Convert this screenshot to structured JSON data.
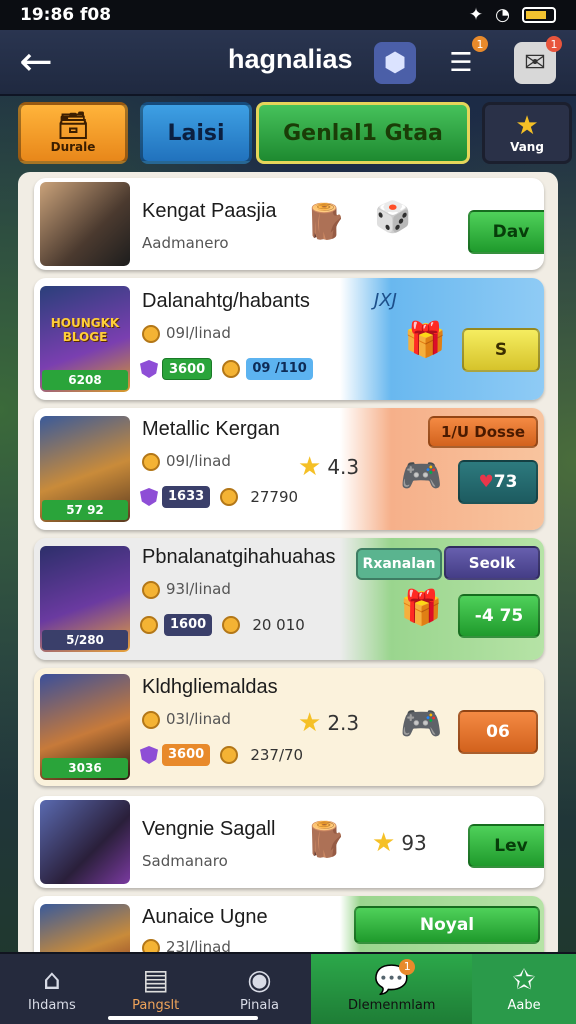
{
  "status_bar": {
    "time": "19:86 f08",
    "icons": [
      "gamepad-icon",
      "wifi-icon",
      "battery-icon"
    ]
  },
  "header": {
    "title": "hagnalias",
    "back_icon": "arrow-left-icon",
    "icons": [
      {
        "name": "cube-icon",
        "badge": ""
      },
      {
        "name": "list-icon",
        "badge": "1"
      },
      {
        "name": "chat-icon",
        "badge": "1"
      }
    ]
  },
  "tabs": [
    {
      "label": "Durale",
      "icon": "chest-icon"
    },
    {
      "label": "Laisi"
    },
    {
      "label": "Genlal1 Gtaa"
    },
    {
      "label": "Vang",
      "icon": "star-icon"
    }
  ],
  "rows": [
    {
      "title": "Kengat Paasjia",
      "subtitle": "Aadmanero",
      "button": "Dav",
      "theme": "plain"
    },
    {
      "title": "Dalanahtg/habants",
      "sub": "09l/linad",
      "thumb_tag": "6208",
      "thumb_banner": "HOUNGKK BLOGE",
      "stat_a": "3600",
      "stat_b": "09 /110",
      "right_label": "JXJ",
      "button": "S",
      "theme": "blue"
    },
    {
      "title": "Metallic Kergan",
      "sub": "09l/linad",
      "thumb_tag": "57 92",
      "stat_a": "1633",
      "stat_b": "27790",
      "rating": "4.3",
      "right_label": "1/U Dosse",
      "button": "73",
      "theme": "orange"
    },
    {
      "title": "Pbnalanatgihahuahas",
      "sub": "93l/linad",
      "thumb_tag": "5/280",
      "stat_a": "1600",
      "stat_b": "20 010",
      "right_label_a": "Rxanalan",
      "right_label_b": "Seolk",
      "button": "-4 75",
      "theme": "green"
    },
    {
      "title": "Kldhgliemaldas",
      "sub": "03l/linad",
      "thumb_tag": "3036",
      "stat_a": "3600",
      "stat_b": "237/70",
      "rating": "2.3",
      "button": "06",
      "theme": "cream"
    },
    {
      "title": "Vengnie Sagall",
      "subtitle": "Sadmanaro",
      "rating": "93",
      "button": "Lev",
      "theme": "plain"
    },
    {
      "title": "Aunaice Ugne",
      "sub": "23l/linad",
      "button": "Noyal",
      "theme": "green"
    }
  ],
  "bottom_nav": [
    {
      "label": "Ihdams",
      "icon": "home-icon"
    },
    {
      "label": "Pangslt",
      "icon": "cards-icon"
    },
    {
      "label": "Pinala",
      "icon": "compass-icon"
    },
    {
      "label": "Dlemenmlam",
      "icon": "chat-bubble-icon",
      "badge": "1"
    },
    {
      "label": "Aabe",
      "icon": "star-outline-icon"
    }
  ],
  "colors": {
    "accent_green": "#2aa43a",
    "accent_orange": "#e8871a",
    "accent_blue": "#2172bd",
    "header_bg": "#2a3550"
  }
}
